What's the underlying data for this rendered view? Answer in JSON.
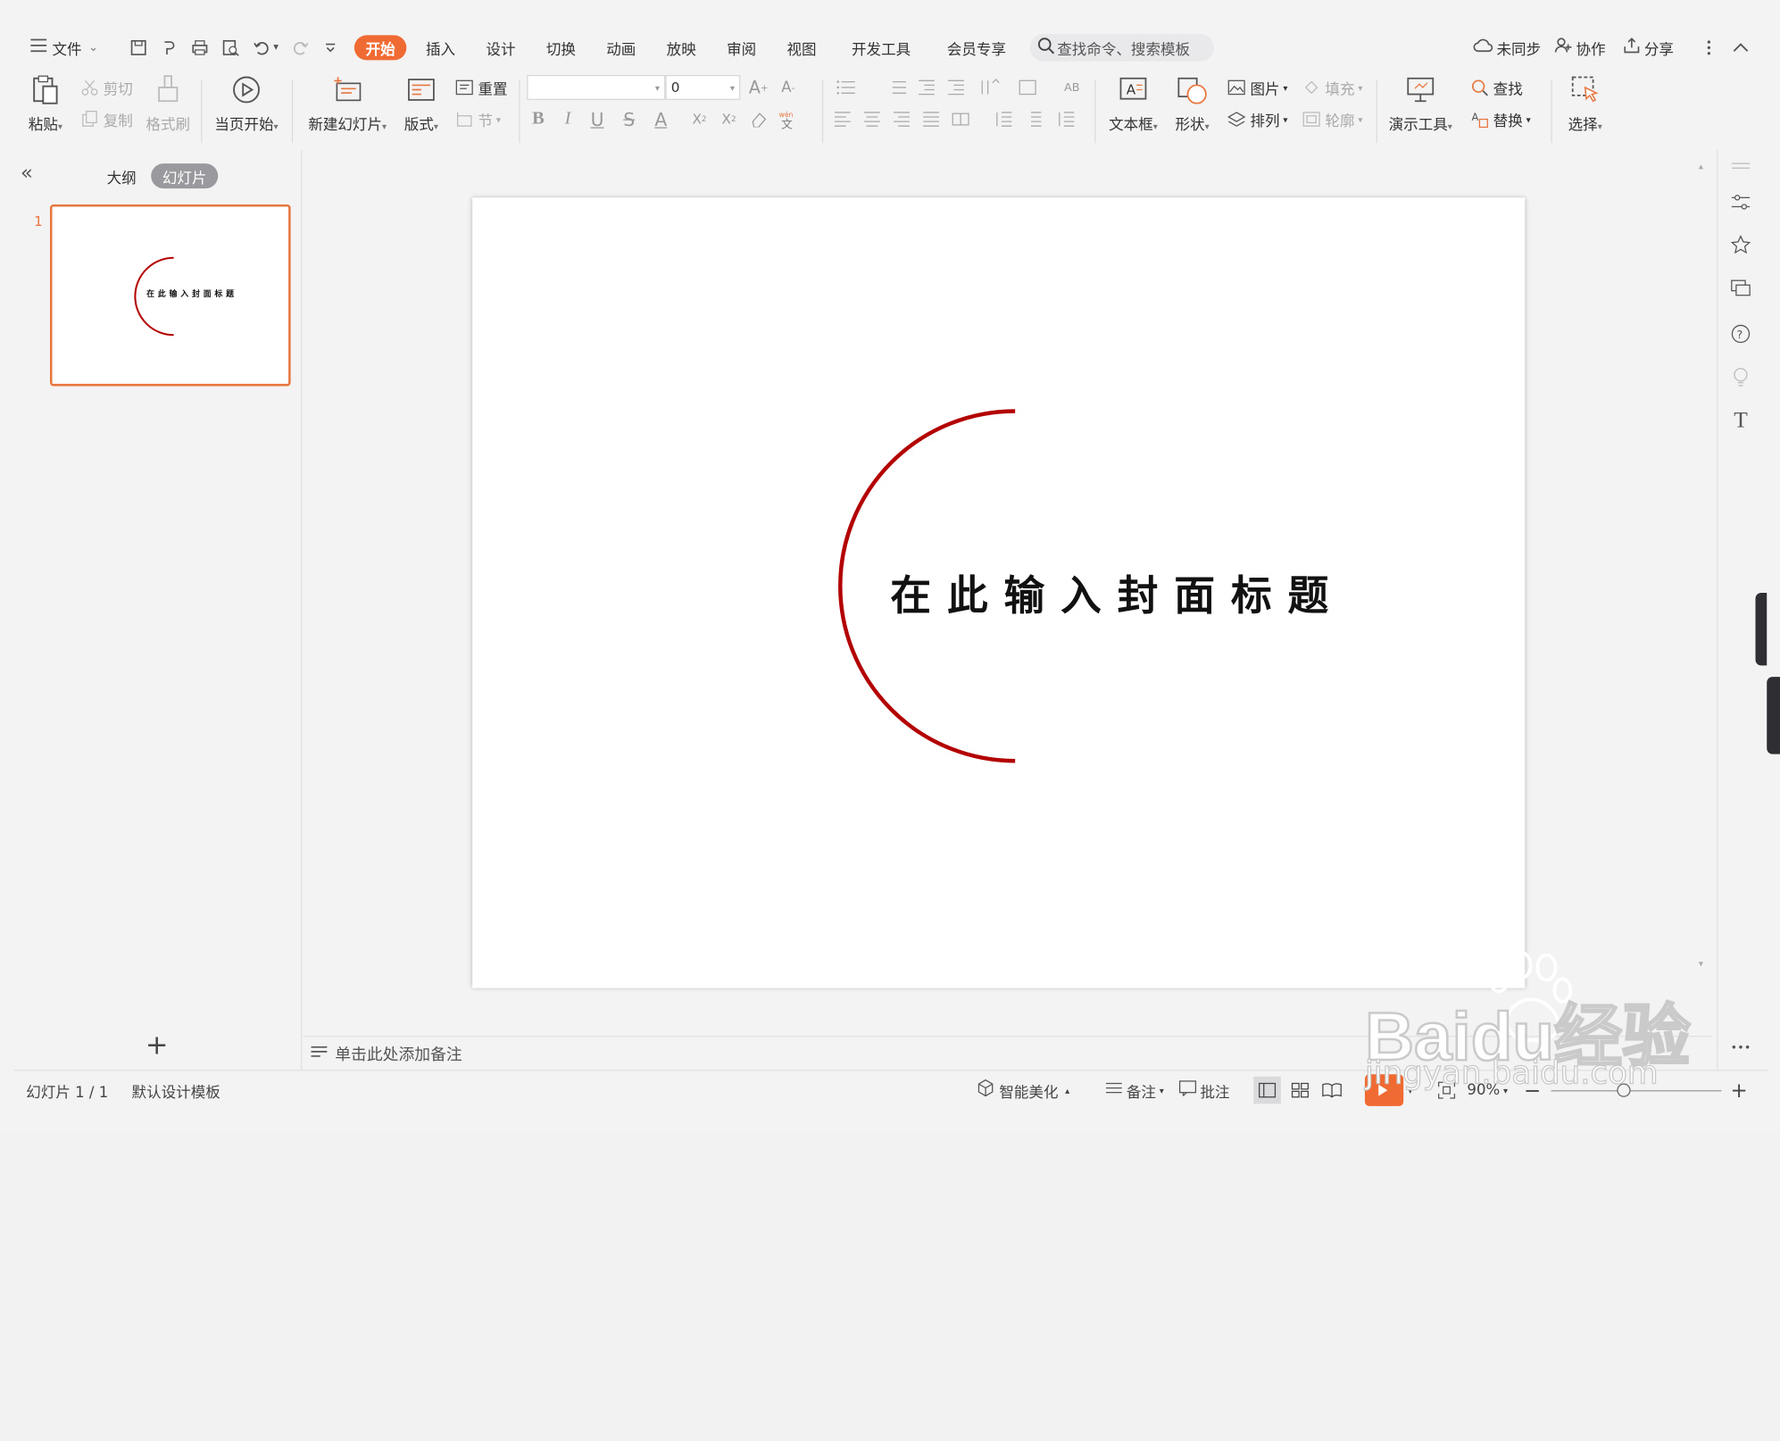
{
  "toolbar": {
    "file_menu": "文件",
    "tabs": [
      "开始",
      "插入",
      "设计",
      "切换",
      "动画",
      "放映",
      "审阅",
      "视图",
      "开发工具",
      "会员专享"
    ],
    "active_tab": "开始",
    "search_placeholder": "查找命令、搜索模板",
    "sync": "未同步",
    "collab": "协作",
    "share": "分享"
  },
  "ribbon": {
    "paste": "粘贴",
    "cut": "剪切",
    "copy": "复制",
    "format_painter": "格式刷",
    "from_current": "当页开始",
    "new_slide": "新建幻灯片",
    "layout": "版式",
    "reset": "重置",
    "section": "节",
    "font_size": "0",
    "textbox": "文本框",
    "shape": "形状",
    "picture": "图片",
    "fill": "填充",
    "arrange": "排列",
    "outline": "轮廓",
    "present_tools": "演示工具",
    "find": "查找",
    "replace": "替换",
    "select": "选择"
  },
  "left_panel": {
    "tab_outline": "大纲",
    "tab_slides": "幻灯片",
    "slide_number": "1",
    "add_slide": "+"
  },
  "slide": {
    "title": "在此输入封面标题",
    "accent_color": "#b30000"
  },
  "notes": {
    "placeholder": "单击此处添加备注"
  },
  "status": {
    "slide_indicator": "幻灯片 1 / 1",
    "template": "默认设计模板",
    "smart_beautify": "智能美化",
    "notes": "备注",
    "comments": "批注",
    "zoom": "90%"
  },
  "watermark": {
    "brand": "Baidu经验",
    "url": "jingyan.baidu.com"
  },
  "colors": {
    "accent": "#f06b34",
    "selection_border": "#e8773f"
  }
}
